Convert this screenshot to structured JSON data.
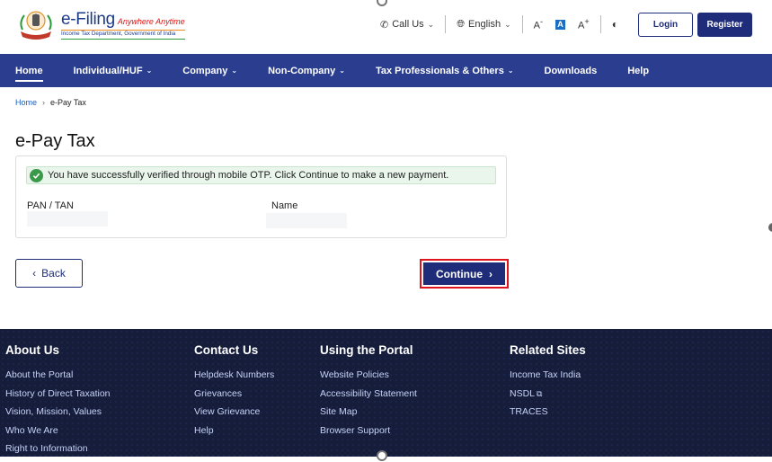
{
  "header": {
    "brand_name": "e-Filing",
    "brand_tagline": "Anywhere Anytime",
    "brand_dept": "Income Tax Department, Government of India",
    "call_us": "Call Us",
    "language": "English",
    "font_decrease": "A",
    "font_normal": "A",
    "font_increase": "A",
    "login_label": "Login",
    "register_label": "Register"
  },
  "nav": {
    "items": [
      {
        "label": "Home"
      },
      {
        "label": "Individual/HUF"
      },
      {
        "label": "Company"
      },
      {
        "label": "Non-Company"
      },
      {
        "label": "Tax Professionals & Others"
      },
      {
        "label": "Downloads"
      },
      {
        "label": "Help"
      }
    ]
  },
  "breadcrumb": {
    "home": "Home",
    "current": "e-Pay Tax"
  },
  "page": {
    "title": "e-Pay Tax",
    "success_message": "You have successfully verified through mobile OTP. Click Continue to make a new payment.",
    "pan_label": "PAN / TAN",
    "name_label": "Name",
    "back_label": "Back",
    "continue_label": "Continue"
  },
  "footer": {
    "about": {
      "title": "About Us",
      "links": [
        "About the Portal",
        "History of Direct Taxation",
        "Vision, Mission, Values",
        "Who We Are",
        "Right to Information"
      ]
    },
    "contact": {
      "title": "Contact Us",
      "links": [
        "Helpdesk Numbers",
        "Grievances",
        "View Grievance",
        "Help"
      ]
    },
    "portal": {
      "title": "Using the Portal",
      "links": [
        "Website Policies",
        "Accessibility Statement",
        "Site Map",
        "Browser Support"
      ]
    },
    "related": {
      "title": "Related Sites",
      "links": [
        "Income Tax India",
        "NSDL",
        "TRACES"
      ]
    }
  },
  "colors": {
    "primary": "#1e2c7a",
    "nav_bg": "#2a3d8f",
    "footer_bg": "#151d3b",
    "success": "#3a9a4a",
    "highlight": "#e0141e"
  }
}
